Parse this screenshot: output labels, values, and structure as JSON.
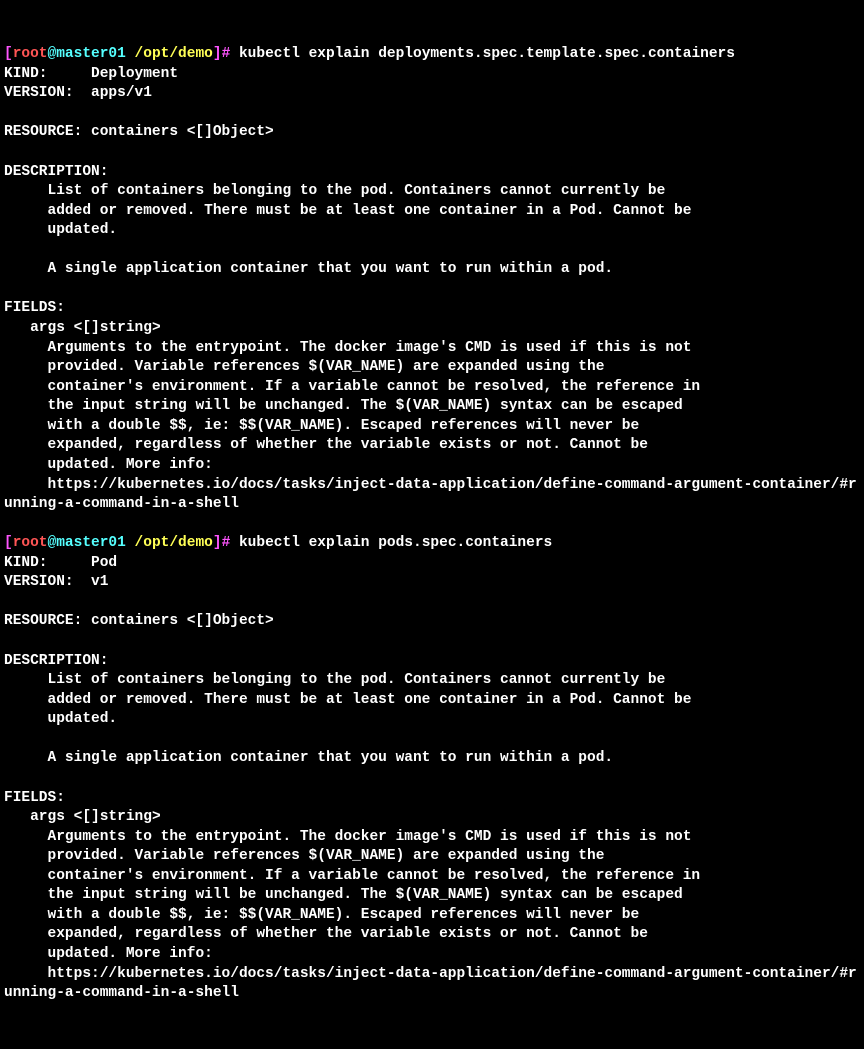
{
  "block1": {
    "prompt": {
      "open": "[",
      "user": "root",
      "at": "@",
      "host": "master01",
      "path": "/opt/demo",
      "close": "]#"
    },
    "command": "kubectl explain deployments.spec.template.spec.containers",
    "output": "KIND:     Deployment\nVERSION:  apps/v1\n\nRESOURCE: containers <[]Object>\n\nDESCRIPTION:\n     List of containers belonging to the pod. Containers cannot currently be\n     added or removed. There must be at least one container in a Pod. Cannot be\n     updated.\n\n     A single application container that you want to run within a pod.\n\nFIELDS:\n   args\t<[]string>\n     Arguments to the entrypoint. The docker image's CMD is used if this is not\n     provided. Variable references $(VAR_NAME) are expanded using the\n     container's environment. If a variable cannot be resolved, the reference in\n     the input string will be unchanged. The $(VAR_NAME) syntax can be escaped\n     with a double $$, ie: $$(VAR_NAME). Escaped references will never be\n     expanded, regardless of whether the variable exists or not. Cannot be\n     updated. More info:\n     https://kubernetes.io/docs/tasks/inject-data-application/define-command-argument-container/#running-a-command-in-a-shell"
  },
  "block2": {
    "prompt": {
      "open": "[",
      "user": "root",
      "at": "@",
      "host": "master01",
      "path": "/opt/demo",
      "close": "]#"
    },
    "command": "kubectl explain pods.spec.containers",
    "output": "KIND:     Pod\nVERSION:  v1\n\nRESOURCE: containers <[]Object>\n\nDESCRIPTION:\n     List of containers belonging to the pod. Containers cannot currently be\n     added or removed. There must be at least one container in a Pod. Cannot be\n     updated.\n\n     A single application container that you want to run within a pod.\n\nFIELDS:\n   args\t<[]string>\n     Arguments to the entrypoint. The docker image's CMD is used if this is not\n     provided. Variable references $(VAR_NAME) are expanded using the\n     container's environment. If a variable cannot be resolved, the reference in\n     the input string will be unchanged. The $(VAR_NAME) syntax can be escaped\n     with a double $$, ie: $$(VAR_NAME). Escaped references will never be\n     expanded, regardless of whether the variable exists or not. Cannot be\n     updated. More info:\n     https://kubernetes.io/docs/tasks/inject-data-application/define-command-argument-container/#running-a-command-in-a-shell"
  }
}
